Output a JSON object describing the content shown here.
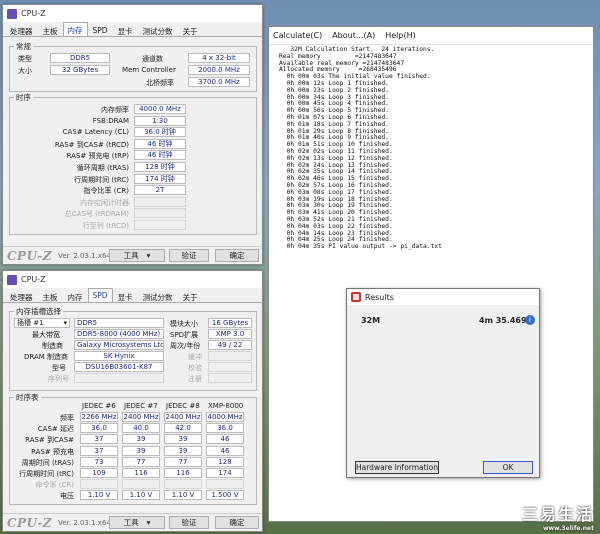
{
  "cpuz1": {
    "title": "CPU-Z",
    "tabs": [
      "处理器",
      "主板",
      "内存",
      "SPD",
      "显卡",
      "测试分数",
      "关于"
    ],
    "active_tab": 2,
    "general": {
      "title": "常规",
      "type_label": "类型",
      "type": "DDR5",
      "size_label": "大小",
      "size": "32 GBytes",
      "channels_label": "通道数",
      "channels": "4 x 32-bit",
      "mc_label": "Mem Controller",
      "mc": "2000.0 MHz",
      "nb_label": "北桥频率",
      "nb": "3700.0 MHz"
    },
    "timings": {
      "title": "时序",
      "rows": [
        {
          "label": "内存频率",
          "value": "4000.0 MHz",
          "dim": false
        },
        {
          "label": "FSB:DRAM",
          "value": "1:30",
          "dim": false
        },
        {
          "label": "CAS# Latency (CL)",
          "value": "36.0 时钟",
          "dim": false
        },
        {
          "label": "RAS# 到CAS# (tRCD)",
          "value": "46 时钟",
          "dim": false
        },
        {
          "label": "RAS# 预充电 (tRP)",
          "value": "46 时钟",
          "dim": false
        },
        {
          "label": "循环周期 (tRAS)",
          "value": "128 时钟",
          "dim": false
        },
        {
          "label": "行周期时间 (tRC)",
          "value": "174 时钟",
          "dim": false
        },
        {
          "label": "指令比率 (CR)",
          "value": "2T",
          "dim": false
        },
        {
          "label": "内存空闲计时器",
          "value": "",
          "dim": true
        },
        {
          "label": "总CAS号 (tRDRAM)",
          "value": "",
          "dim": true
        },
        {
          "label": "行至列 (tRCD)",
          "value": "",
          "dim": true
        }
      ]
    },
    "version": "Ver. 2.03.1.x64",
    "tools": "工具",
    "validate": "验证",
    "ok": "确定"
  },
  "cpuz2": {
    "title": "CPU-Z",
    "tabs": [
      "处理器",
      "主板",
      "内存",
      "SPD",
      "显卡",
      "测试分数",
      "关于"
    ],
    "active_tab": 3,
    "slot_group": "内存插槽选择",
    "slot": "插槽 #1",
    "slot_type": "DDR5",
    "module_size_label": "模块大小",
    "module_size": "16 GBytes",
    "max_bw_label": "最大带宽",
    "max_bw": "DDR5-8000 (4000 MHz)",
    "spd_ext_label": "SPD扩展",
    "spd_ext": "XMP 3.0",
    "mfr_label": "制造商",
    "mfr": "Galaxy Microsystems Ltd.",
    "week_label": "周次/年份",
    "week": "49 / 22",
    "dram_label": "DRAM 制造商",
    "dram": "SK Hynix",
    "buffer_label": "缓冲",
    "part_label": "型号",
    "part": "DSU16B03601-K87",
    "check_label": "校验",
    "serial_label": "序列号",
    "reg_label": "注册",
    "timing_table": {
      "title": "时序表",
      "headers": [
        "JEDEC #6",
        "JEDEC #7",
        "JEDEC #8",
        "XMP-8000"
      ],
      "rows": [
        {
          "label": "频率",
          "values": [
            "2266 MHz",
            "2400 MHz",
            "2400 MHz",
            "4000 MHz"
          ]
        },
        {
          "label": "CAS# 延迟",
          "values": [
            "36.0",
            "40.0",
            "42.0",
            "36.0"
          ]
        },
        {
          "label": "RAS# 到CAS#",
          "values": [
            "37",
            "39",
            "39",
            "46"
          ]
        },
        {
          "label": "RAS# 预充电",
          "values": [
            "37",
            "39",
            "39",
            "46"
          ]
        },
        {
          "label": "周期时间 (tRAS)",
          "values": [
            "73",
            "77",
            "77",
            "128"
          ]
        },
        {
          "label": "行周期时间 (tRC)",
          "values": [
            "109",
            "116",
            "116",
            "174"
          ]
        },
        {
          "label": "命令率 (CR)",
          "values": [
            "",
            "",
            "",
            ""
          ]
        },
        {
          "label": "电压",
          "values": [
            "1.10 V",
            "1.10 V",
            "1.10 V",
            "1.500 V"
          ]
        }
      ]
    },
    "version": "Ver. 2.03.1.x64",
    "tools": "工具",
    "validate": "验证",
    "ok": "确定"
  },
  "superpi": {
    "menu": [
      "Calculate(C)",
      "About...(A)",
      "Help(H)"
    ],
    "lines": [
      "   32M Calculation Start.  24 iterations.",
      "Real memory         =2147483647",
      "Available real memory =2147483647",
      "Allocated memory     =268435496",
      "  0h 00m 03s The initial value finished.",
      "  0h 00m 12s Loop 1 finished.",
      "  0h 00m 23s Loop 2 finished.",
      "  0h 00m 34s Loop 3 finished.",
      "  0h 00m 45s Loop 4 finished.",
      "  0h 00m 56s Loop 5 finished.",
      "  0h 01m 07s Loop 6 finished.",
      "  0h 01m 18s Loop 7 finished.",
      "  0h 01m 29s Loop 8 finished.",
      "  0h 01m 40s Loop 9 finished.",
      "  0h 01m 51s Loop 10 finished.",
      "  0h 02m 02s Loop 11 finished.",
      "  0h 02m 13s Loop 12 finished.",
      "  0h 02m 24s Loop 13 finished.",
      "  0h 02m 35s Loop 14 finished.",
      "  0h 02m 46s Loop 15 finished.",
      "  0h 02m 57s Loop 16 finished.",
      "  0h 03m 08s Loop 17 finished.",
      "  0h 03m 19s Loop 18 finished.",
      "  0h 03m 30s Loop 19 finished.",
      "  0h 03m 41s Loop 20 finished.",
      "  0h 03m 52s Loop 21 finished.",
      "  0h 04m 03s Loop 22 finished.",
      "  0h 04m 14s Loop 23 finished.",
      "  0h 04m 25s Loop 24 finished.",
      "  0h 04m 35s PI value output -> pi_data.txt"
    ]
  },
  "results": {
    "title": "Results",
    "label": "32M",
    "time": "4m 35.469s",
    "hw_button": "Hardware Information",
    "ok_button": "OK"
  },
  "watermark": "三易生活",
  "watermark_url": "www.3elife.net"
}
